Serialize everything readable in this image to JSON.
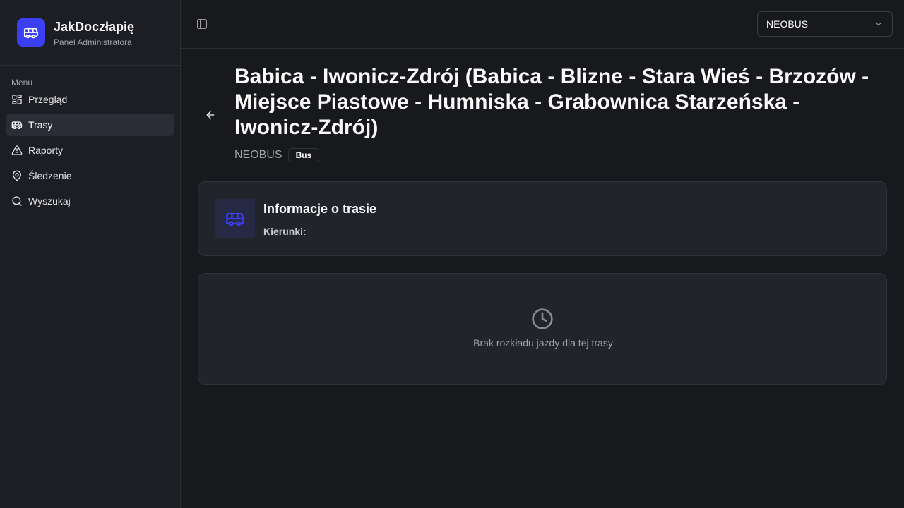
{
  "app": {
    "title": "JakDoczłapię",
    "subtitle": "Panel Administratora",
    "logo_icon": "bus-icon",
    "accent_color": "#3b3ff5"
  },
  "sidebar": {
    "menu_label": "Menu",
    "items": [
      {
        "label": "Przegląd",
        "icon": "grid-icon",
        "active": false
      },
      {
        "label": "Trasy",
        "icon": "bus-icon",
        "active": true
      },
      {
        "label": "Raporty",
        "icon": "warning-triangle-icon",
        "active": false
      },
      {
        "label": "Śledzenie",
        "icon": "map-pin-icon",
        "active": false
      },
      {
        "label": "Wyszukaj",
        "icon": "search-icon",
        "active": false
      }
    ]
  },
  "header": {
    "toggle_icon": "sidebar-toggle-icon",
    "operator_select": {
      "value": "NEOBUS",
      "icon": "chevron-down-icon"
    }
  },
  "route": {
    "title": "Babica - Iwonicz-Zdrój (Babica - Blizne - Stara Wieś - Brzozów - Miejsce Piastowe - Humniska - Grabownica Starzeńska - Iwonicz-Zdrój)",
    "operator": "NEOBUS",
    "type_badge": "Bus",
    "back_icon": "arrow-left-icon"
  },
  "info_card": {
    "title": "Informacje o trasie",
    "directions_label": "Kierunki:",
    "icon": "bus-icon"
  },
  "schedule": {
    "empty_text": "Brak rozkładu jazdy dla tej trasy",
    "icon": "clock-icon"
  }
}
